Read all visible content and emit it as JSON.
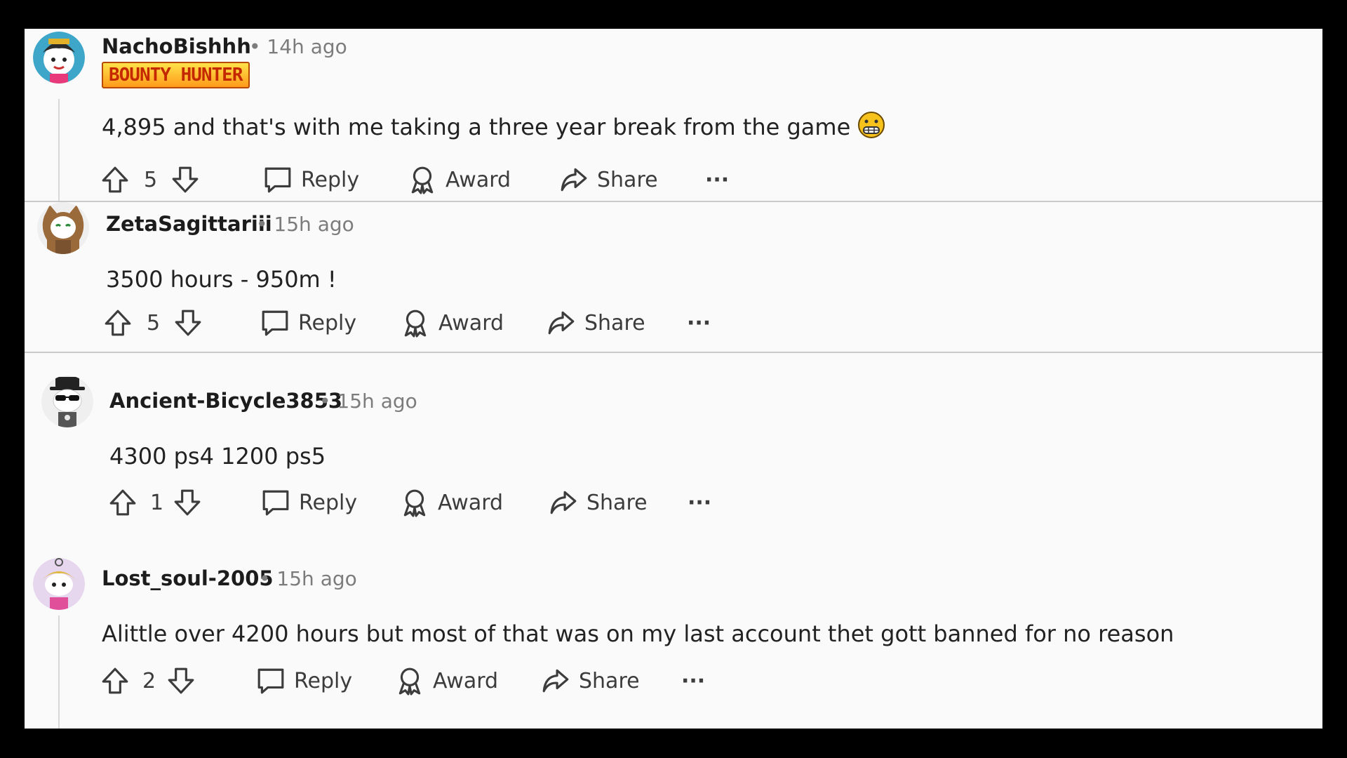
{
  "comments": [
    {
      "username": "NachoBishhh",
      "time": "• 14h ago",
      "flair": "BOUNTY HUNTER",
      "text": "4,895 and that's with me taking a three year break from the game",
      "emoji": "grimacing-face",
      "votes": "5",
      "reply": "Reply",
      "award": "Award",
      "share": "Share",
      "more": "···"
    },
    {
      "username": "ZetaSagittariii",
      "time": "• 15h ago",
      "text": "3500 hours - 950m !",
      "votes": "5",
      "reply": "Reply",
      "award": "Award",
      "share": "Share",
      "more": "···"
    },
    {
      "username": "Ancient-Bicycle3853",
      "time": "• 15h ago",
      "text": "4300 ps4 1200 ps5",
      "votes": "1",
      "reply": "Reply",
      "award": "Award",
      "share": "Share",
      "more": "···"
    },
    {
      "username": "Lost_soul-2005",
      "time": "• 15h ago",
      "text": "Alittle over 4200 hours but most of that was on my last account thet gott banned for no reason",
      "votes": "2",
      "reply": "Reply",
      "award": "Award",
      "share": "Share",
      "more": "···"
    }
  ],
  "icons": {
    "upvote": "arrow-up-outline-icon",
    "downvote": "arrow-down-outline-icon",
    "reply": "speech-bubble-icon",
    "award": "ribbon-award-icon",
    "share": "curved-arrow-share-icon",
    "more": "ellipsis-icon"
  },
  "colors": {
    "background": "#fafafa",
    "frame": "#000000",
    "text": "#1c1c1c",
    "meta": "#7c7c7c",
    "divider": "#c9c9c9"
  }
}
